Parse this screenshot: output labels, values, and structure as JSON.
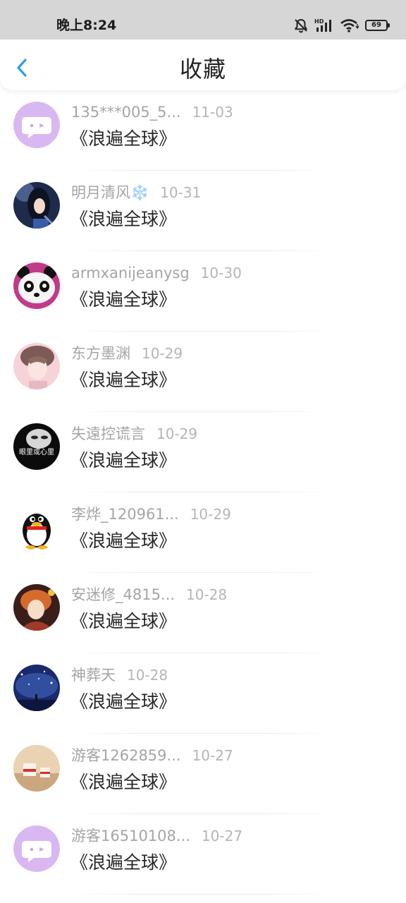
{
  "status_bar": {
    "time": "晚上8:24",
    "battery_level": "69",
    "icons": [
      "bell-muted-icon",
      "hd-signal-icon",
      "wifi-icon",
      "battery-icon"
    ]
  },
  "header": {
    "title": "收藏",
    "back_icon": "chevron-left-icon"
  },
  "colors": {
    "accent": "#2a9ee8",
    "title_text": "#222222",
    "meta_text": "#a5a5a5",
    "status_bar_bg": "#d6d6d6"
  },
  "items": [
    {
      "user": "135***005_5...",
      "date": "11-03",
      "title": "《浪遍全球》",
      "avatar": "chat-bubble-avatar"
    },
    {
      "user": "明月清风❄️",
      "date": "10-31",
      "title": "《浪遍全球》",
      "avatar": "girl-portrait-avatar"
    },
    {
      "user": "armxanijeanysg",
      "date": "10-30",
      "title": "《浪遍全球》",
      "avatar": "panda-avatar"
    },
    {
      "user": "东方墨渊",
      "date": "10-29",
      "title": "《浪遍全球》",
      "avatar": "anime-boy-avatar"
    },
    {
      "user": "失遠控谎言",
      "date": "10-29",
      "title": "《浪遍全球》",
      "avatar": "dark-face-avatar",
      "avatar_text": "眼里或心里"
    },
    {
      "user": "李烨_120961...",
      "date": "10-29",
      "title": "《浪遍全球》",
      "avatar": "penguin-avatar"
    },
    {
      "user": "安迷修_4815...",
      "date": "10-28",
      "title": "《浪遍全球》",
      "avatar": "anime-character-avatar"
    },
    {
      "user": "神葬天",
      "date": "10-28",
      "title": "《浪遍全球》",
      "avatar": "starry-night-avatar"
    },
    {
      "user": "游客1262859...",
      "date": "10-27",
      "title": "《浪遍全球》",
      "avatar": "cake-avatar"
    },
    {
      "user": "游客16510108...",
      "date": "10-27",
      "title": "《浪遍全球》",
      "avatar": "chat-bubble-avatar"
    }
  ]
}
